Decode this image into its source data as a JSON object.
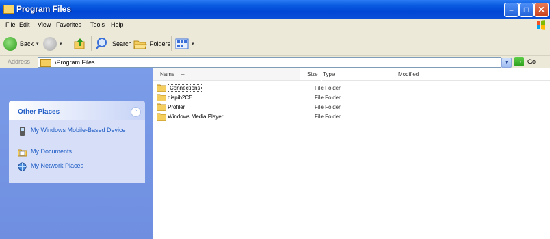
{
  "window": {
    "title": "Program Files"
  },
  "menu": {
    "items": [
      "File",
      "Edit",
      "View",
      "Favorites",
      "Tools",
      "Help"
    ]
  },
  "toolbar": {
    "back_label": "Back",
    "search_label": "Search",
    "folders_label": "Folders"
  },
  "address": {
    "label": "Address",
    "value": "\\Program Files",
    "go_label": "Go"
  },
  "other_places": {
    "title": "Other Places",
    "items": [
      {
        "label": "My Windows Mobile-Based Device",
        "icon": "device-icon"
      },
      {
        "label": "My Documents",
        "icon": "documents-folder-icon"
      },
      {
        "label": "My Network Places",
        "icon": "network-places-icon"
      }
    ]
  },
  "columns": {
    "name": "Name",
    "size": "Size",
    "type": "Type",
    "modified": "Modified"
  },
  "files": [
    {
      "name": "Connections",
      "type": "File Folder"
    },
    {
      "name": "dispib2CE",
      "type": "File Folder"
    },
    {
      "name": "Profiler",
      "type": "File Folder"
    },
    {
      "name": "Windows Media Player",
      "type": "File Folder"
    }
  ],
  "colors": {
    "titlebar": "#0a5ae0",
    "taskpane": "#7b9ce8",
    "link": "#215dc6"
  }
}
